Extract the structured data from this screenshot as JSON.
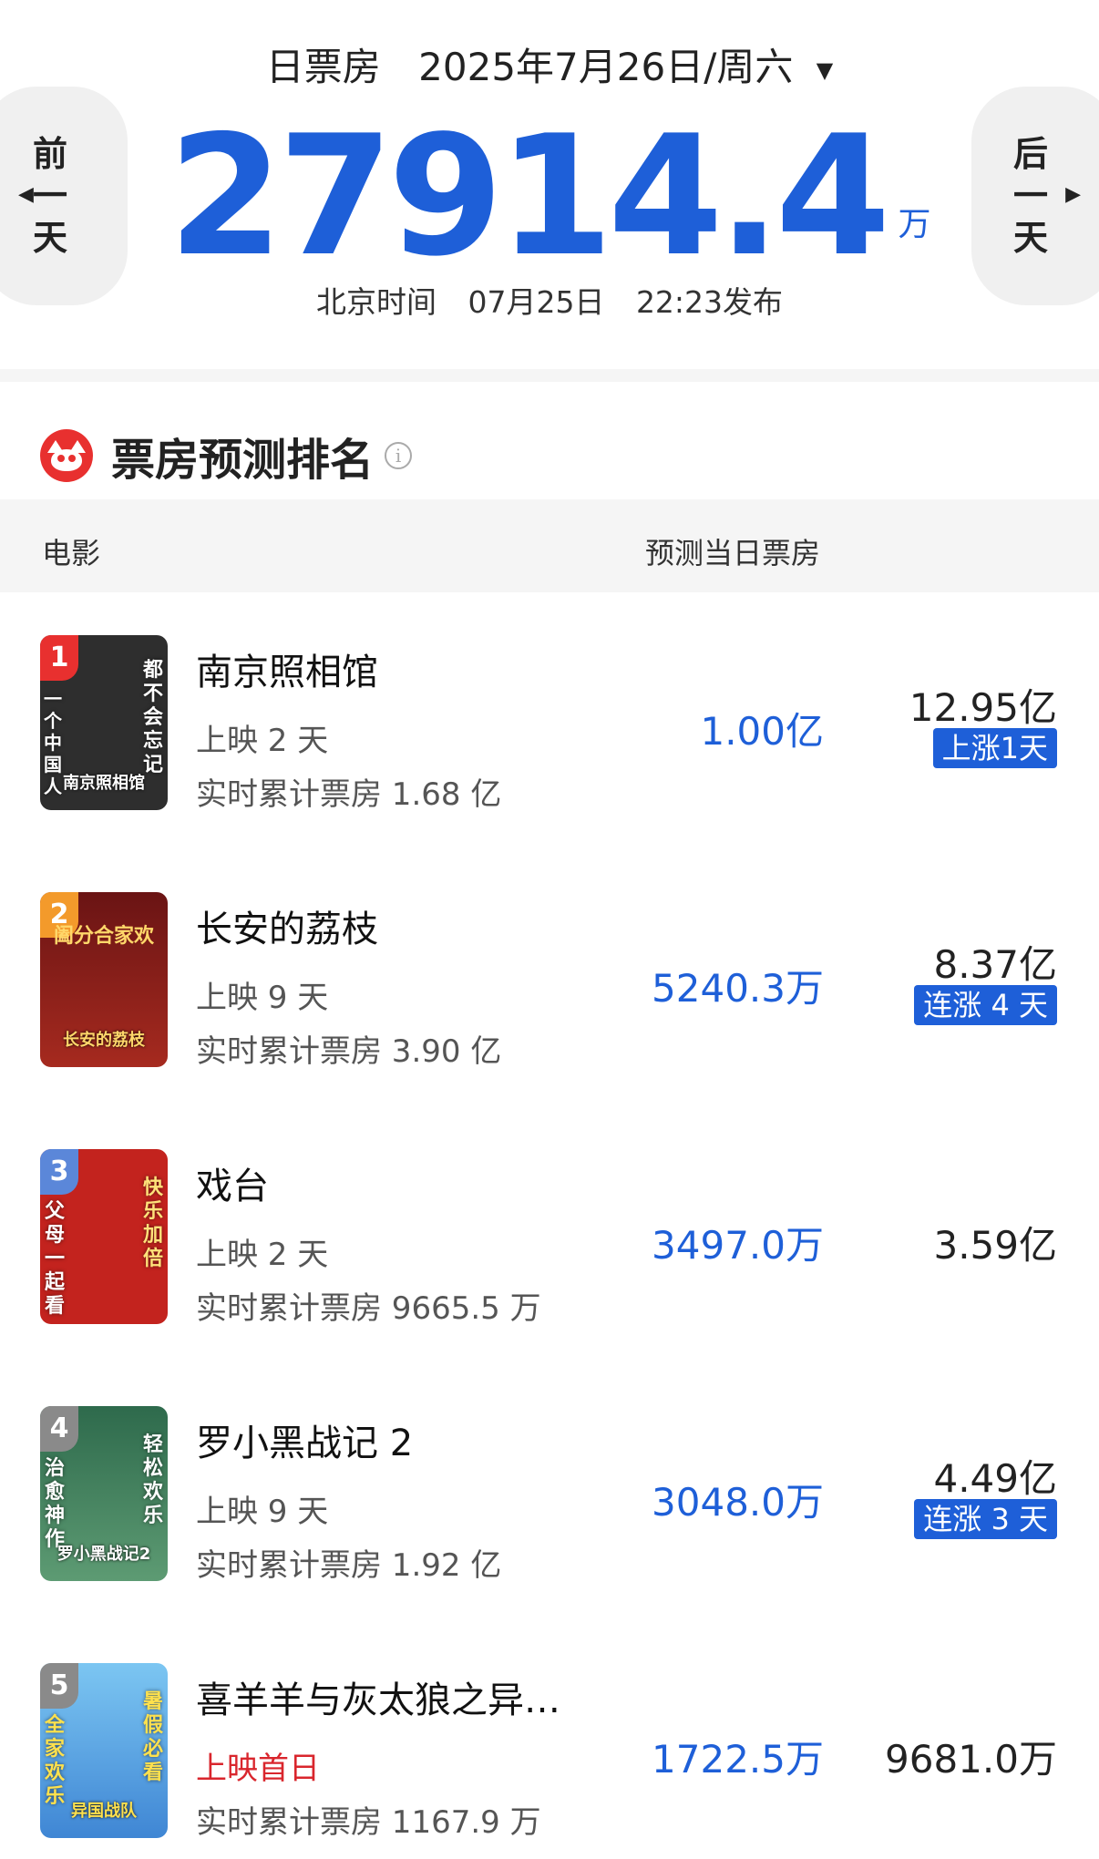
{
  "header": {
    "label": "日票房",
    "date": "2025年7月26日/周六",
    "total": "27914.4",
    "unit": "万",
    "pub_prefix": "北京时间",
    "pub_date": "07月25日",
    "pub_time": "22:23发布",
    "prev_label": "前一天",
    "next_label": "后一天"
  },
  "section": {
    "title": "票房预测排名",
    "col_movie": "电影",
    "col_pred": "预测当日票房"
  },
  "movies": [
    {
      "rank": "1",
      "title": "南京照相馆",
      "days": "上映 2 天",
      "cumulative": "实时累计票房 1.68 亿",
      "predicted": "1.00亿",
      "total": "12.95亿",
      "badge": "上涨1天",
      "rank_color": "#e8302f",
      "poster_bg": "#2b2b2b",
      "poster_left": "一个中国人",
      "poster_right": "都不会忘记",
      "poster_title": "南京照相馆"
    },
    {
      "rank": "2",
      "title": "长安的荔枝",
      "days": "上映 9 天",
      "cumulative": "实时累计票房 3.90 亿",
      "predicted": "5240.3万",
      "total": "8.37亿",
      "badge": "连涨 4 天",
      "rank_color": "#f39a2b",
      "poster_bg": "#8a1f1f",
      "poster_top": "阖分合家欢",
      "poster_title": "长安的荔枝"
    },
    {
      "rank": "3",
      "title": "戏台",
      "days": "上映 2 天",
      "cumulative": "实时累计票房 9665.5 万",
      "predicted": "3497.0万",
      "total": "3.59亿",
      "badge": "",
      "rank_color": "#5b87d9",
      "poster_bg": "#c3231e",
      "poster_left": "父母一起看",
      "poster_right": "快乐加倍",
      "poster_title": ""
    },
    {
      "rank": "4",
      "title": "罗小黑战记 2",
      "days": "上映 9 天",
      "cumulative": "实时累计票房 1.92 亿",
      "predicted": "3048.0万",
      "total": "4.49亿",
      "badge": "连涨 3 天",
      "rank_color": "#8a8a8a",
      "poster_bg": "#3e7a5c",
      "poster_left": "治愈神作",
      "poster_right": "轻松欢乐",
      "poster_title": "罗小黑战记2"
    },
    {
      "rank": "5",
      "title": "喜羊羊与灰太狼之异…",
      "days": "上映首日",
      "cumulative": "实时累计票房 1167.9 万",
      "predicted": "1722.5万",
      "total": "9681.0万",
      "badge": "",
      "rank_color": "#8a8a8a",
      "poster_bg": "#5aa8e8",
      "poster_left": "全家欢乐",
      "poster_right": "暑假必看",
      "poster_title": "异国战队"
    }
  ]
}
